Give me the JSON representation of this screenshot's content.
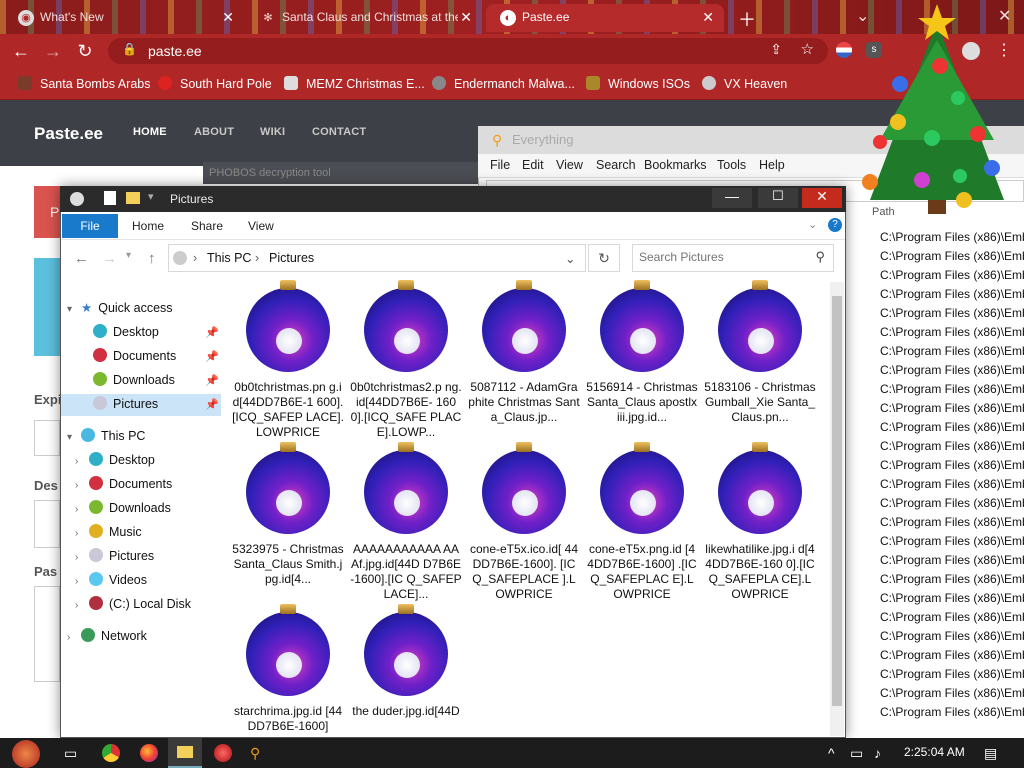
{
  "browser": {
    "tabs": [
      {
        "label": "What's New",
        "icon": "chrome-icon"
      },
      {
        "label": "Santa Claus and Christmas at the",
        "icon": "snowflake-icon"
      },
      {
        "label": "Paste.ee",
        "icon": "paste-icon"
      }
    ],
    "url": "paste.ee",
    "bookmarks": [
      "Santa Bombs Arabs",
      "South Hard Pole",
      "MEMZ Christmas E...",
      "Endermanch Malwa...",
      "Windows ISOs",
      "VX Heaven"
    ]
  },
  "site": {
    "logo": "Paste.ee",
    "nav": [
      "HOME",
      "ABOUT",
      "WIKI",
      "CONTACT"
    ],
    "phobos_label": "PHOBOS decryption tool",
    "side_labels": [
      "Expi",
      "Des",
      "Pas"
    ]
  },
  "everything": {
    "title": "Everything",
    "menu": [
      "File",
      "Edit",
      "View",
      "Search",
      "Bookmarks",
      "Tools",
      "Help"
    ],
    "path_header": "Path",
    "row_text": "C:\\Program Files (x86)\\Emb"
  },
  "explorer": {
    "title": "Pictures",
    "ribbon_tabs": [
      "File",
      "Home",
      "Share",
      "View"
    ],
    "breadcrumb": [
      "This PC",
      "Pictures"
    ],
    "search_placeholder": "Search Pictures",
    "sidebar": {
      "quick_access": "Quick access",
      "quick_items": [
        "Desktop",
        "Documents",
        "Downloads",
        "Pictures"
      ],
      "this_pc": "This PC",
      "pc_items": [
        "Desktop",
        "Documents",
        "Downloads",
        "Music",
        "Pictures",
        "Videos",
        "(C:) Local Disk"
      ],
      "network": "Network"
    },
    "files": [
      "0b0tchristmas.pn g.id[44DD7B6E-1 600].[ICQ_SAFEP LACE].LOWPRICE",
      "0b0tchristmas2.p ng.id[44DD7B6E- 1600].[ICQ_SAFE PLACE].LOWP...",
      "5087112 - AdamGraphite Christmas Santa_Claus.jp...",
      "5156914 - Christmas Santa_Claus apostlxiii.jpg.id...",
      "5183106 - Christmas Gumball_Xie Santa_Claus.pn...",
      "5323975 - Christmas Santa_Claus Smith.jpg.id[4...",
      "AAAAAAAAAAA AAAf.jpg.id[44D D7B6E-1600].[IC Q_SAFEPLACE]...",
      "cone-eT5x.ico.id[ 44DD7B6E-1600]. [ICQ_SAFEPLACE ].LOWPRICE",
      "cone-eT5x.png.id [44DD7B6E-1600] .[ICQ_SAFEPLAC E].LOWPRICE",
      "likewhatilike.jpg.i d[44DD7B6E-160 0].[ICQ_SAFEPLA CE].LOWPRICE",
      "starchrima.jpg.id [44DD7B6E-1600]",
      "the duder.jpg.id[44D"
    ]
  },
  "taskbar": {
    "clock": "2:25:04 AM"
  }
}
